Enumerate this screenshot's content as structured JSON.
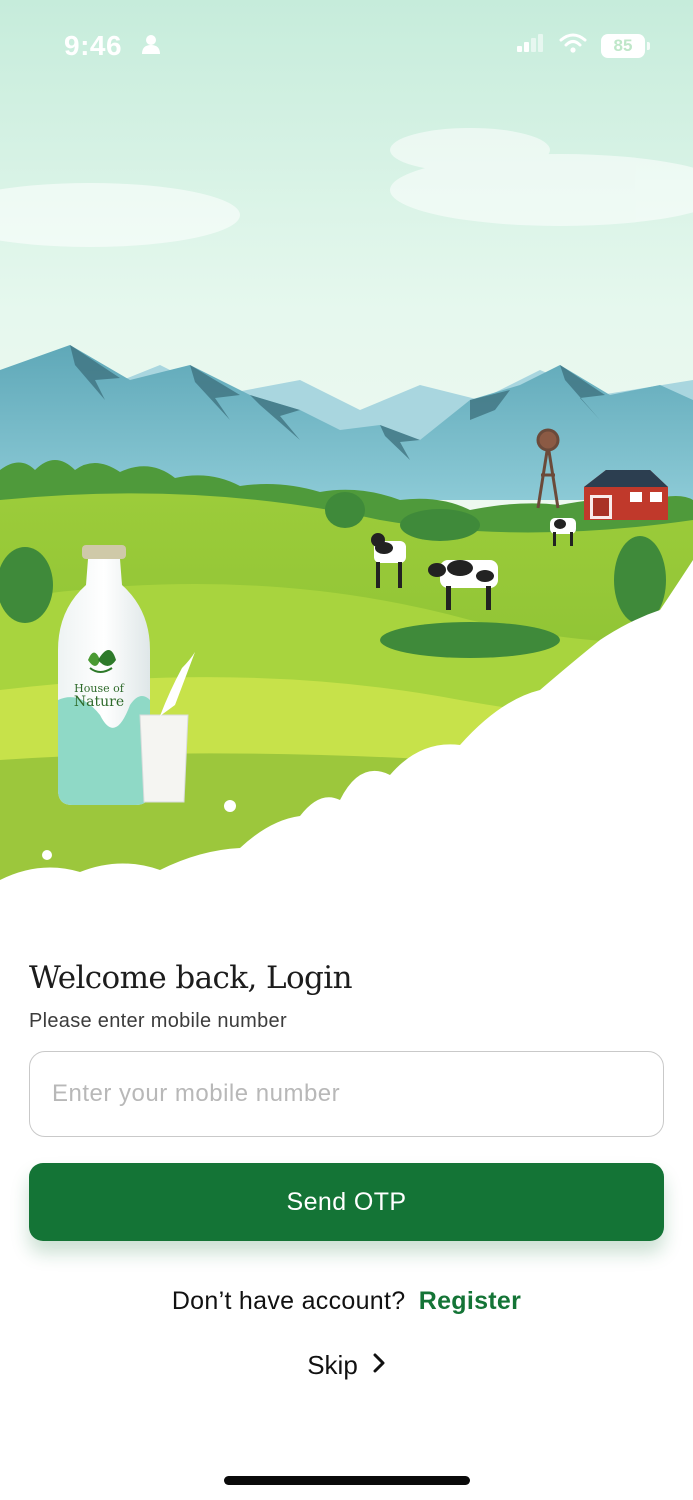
{
  "status_bar": {
    "time": "9:46",
    "battery": "85"
  },
  "brand": {
    "name_line1": "House of",
    "name_line2": "Nature"
  },
  "login": {
    "title": "Welcome back, Login",
    "subtitle": "Please enter mobile number",
    "mobile_placeholder": "Enter your mobile number",
    "send_otp_label": "Send OTP",
    "no_account_text": "Don’t have account?",
    "register_label": "Register",
    "skip_label": "Skip"
  },
  "colors": {
    "primary": "#147436",
    "sky": "#d8f3e8",
    "grass": "#8cc63f"
  },
  "icons": {
    "person": "person-icon",
    "signal": "signal-icon",
    "wifi": "wifi-icon",
    "skip_chevron": "chevron-right-icon"
  }
}
